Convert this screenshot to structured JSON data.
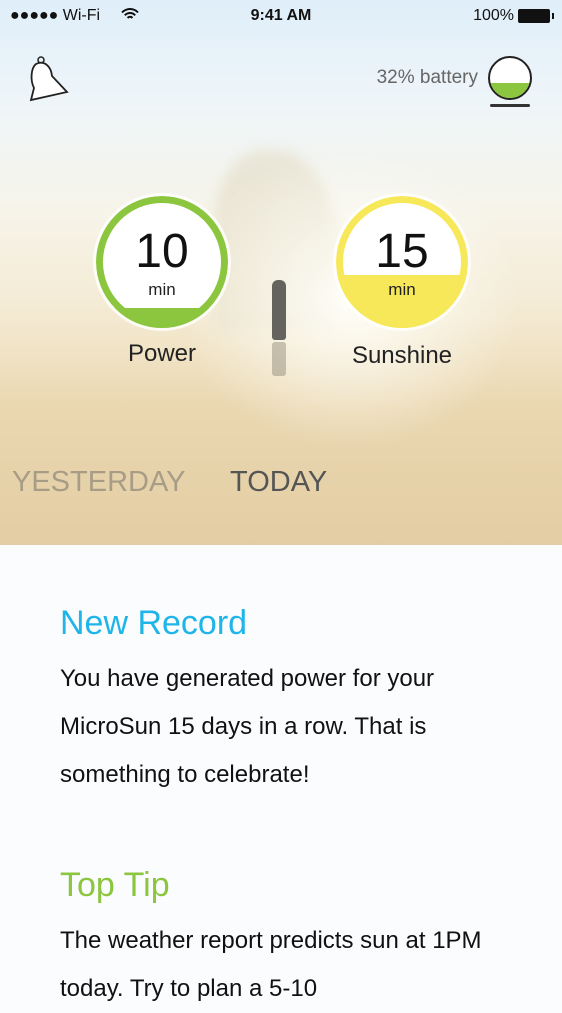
{
  "status_bar": {
    "carrier": "●●●●● Wi-Fi",
    "wifi_icon": "wifi-icon",
    "time": "9:41 AM",
    "battery": "100%"
  },
  "header": {
    "bell_icon": "bell-icon",
    "battery_label": "32% battery",
    "battery_level_percent": 32
  },
  "gauges": [
    {
      "value": "10",
      "unit": "min",
      "label": "Power",
      "fill_fraction": 0.15,
      "color": "#8cc63f"
    },
    {
      "value": "15",
      "unit": "min",
      "label": "Sunshine",
      "fill_fraction": 0.4,
      "color": "#f7e85a"
    }
  ],
  "tabs": {
    "yesterday": "YESTERDAY",
    "today": "TODAY"
  },
  "cards": [
    {
      "title": "New Record",
      "title_color": "#1fb5e8",
      "body": "You have generated power for your MicroSun 15 days in a row. That is something to celebrate!"
    },
    {
      "title": "Top Tip",
      "title_color": "#8cc63f",
      "body": "The weather report predicts sun at 1PM today. Try to plan a 5-10"
    }
  ]
}
